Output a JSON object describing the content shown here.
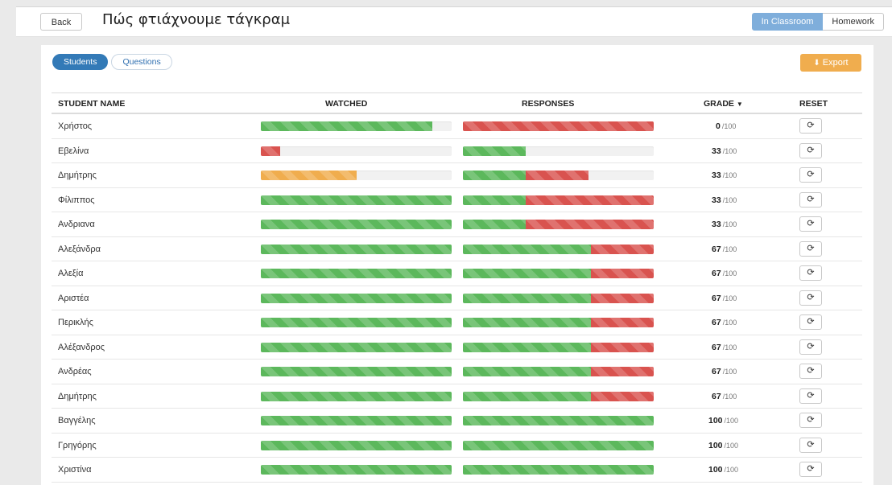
{
  "header": {
    "back_label": "Back",
    "title": "Πώς φτιάχνουμε τάγκραμ",
    "mode_in_classroom": "In Classroom",
    "mode_homework": "Homework"
  },
  "tabs": {
    "students": "Students",
    "questions": "Questions"
  },
  "export_label": "Export",
  "columns": {
    "student_name": "STUDENT NAME",
    "watched": "WATCHED",
    "responses": "RESPONSES",
    "grade": "GRADE",
    "reset": "RESET"
  },
  "icons": {
    "export": "download-icon",
    "grade_sort": "caret-down-icon",
    "reset": "refresh-icon"
  },
  "colors": {
    "correct": "#5cb85c",
    "incorrect": "#d9534f",
    "partial": "#f0ad4e",
    "primary": "#337ab7"
  },
  "grade_max": "/100",
  "rows": [
    {
      "name": "Χρήστος",
      "watched": 0.9,
      "watched_color": "green",
      "resp_correct": 0.0,
      "resp_incorrect": 1.0,
      "grade": "0"
    },
    {
      "name": "Εβελίνα",
      "watched": 0.1,
      "watched_color": "red",
      "resp_correct": 0.33,
      "resp_incorrect": 0.0,
      "grade": "33"
    },
    {
      "name": "Δημήτρης",
      "watched": 0.5,
      "watched_color": "orange",
      "resp_correct": 0.33,
      "resp_incorrect": 0.33,
      "grade": "33"
    },
    {
      "name": "Φίλιππος",
      "watched": 1.0,
      "watched_color": "green",
      "resp_correct": 0.33,
      "resp_incorrect": 0.67,
      "grade": "33"
    },
    {
      "name": "Ανδριανα",
      "watched": 1.0,
      "watched_color": "green",
      "resp_correct": 0.33,
      "resp_incorrect": 0.67,
      "grade": "33"
    },
    {
      "name": "Αλεξάνδρα",
      "watched": 1.0,
      "watched_color": "green",
      "resp_correct": 0.67,
      "resp_incorrect": 0.33,
      "grade": "67"
    },
    {
      "name": "Αλεξία",
      "watched": 1.0,
      "watched_color": "green",
      "resp_correct": 0.67,
      "resp_incorrect": 0.33,
      "grade": "67"
    },
    {
      "name": "Αριστέα",
      "watched": 1.0,
      "watched_color": "green",
      "resp_correct": 0.67,
      "resp_incorrect": 0.33,
      "grade": "67"
    },
    {
      "name": "Περικλής",
      "watched": 1.0,
      "watched_color": "green",
      "resp_correct": 0.67,
      "resp_incorrect": 0.33,
      "grade": "67"
    },
    {
      "name": "Αλέξανδρος",
      "watched": 1.0,
      "watched_color": "green",
      "resp_correct": 0.67,
      "resp_incorrect": 0.33,
      "grade": "67"
    },
    {
      "name": "Ανδρέας",
      "watched": 1.0,
      "watched_color": "green",
      "resp_correct": 0.67,
      "resp_incorrect": 0.33,
      "grade": "67"
    },
    {
      "name": "Δημήτρης",
      "watched": 1.0,
      "watched_color": "green",
      "resp_correct": 0.67,
      "resp_incorrect": 0.33,
      "grade": "67"
    },
    {
      "name": "Βαγγέλης",
      "watched": 1.0,
      "watched_color": "green",
      "resp_correct": 1.0,
      "resp_incorrect": 0.0,
      "grade": "100"
    },
    {
      "name": "Γρηγόρης",
      "watched": 1.0,
      "watched_color": "green",
      "resp_correct": 1.0,
      "resp_incorrect": 0.0,
      "grade": "100"
    },
    {
      "name": "Χριστίνα",
      "watched": 1.0,
      "watched_color": "green",
      "resp_correct": 1.0,
      "resp_incorrect": 0.0,
      "grade": "100"
    }
  ]
}
